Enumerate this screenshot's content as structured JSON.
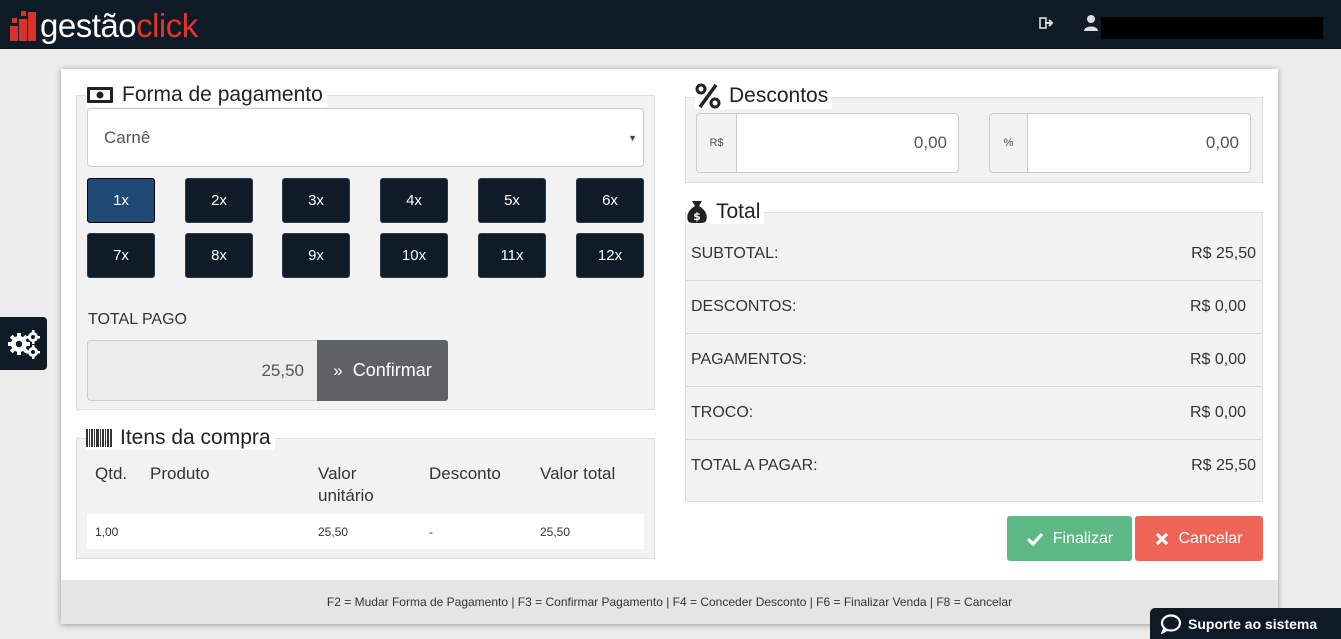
{
  "topbar": {
    "logo_part1": "gestão",
    "logo_part2": "click",
    "logout_icon": "sign-out-icon",
    "user_icon": "user-icon",
    "user_name": "",
    "colors": {
      "bar": "#0f1a27",
      "brand_red": "#e0342c"
    }
  },
  "payment": {
    "title": "Forma de pagamento",
    "title_icon": "money-bill-icon",
    "method_value": "Carnê",
    "installments": [
      "1x",
      "2x",
      "3x",
      "4x",
      "5x",
      "6x",
      "7x",
      "8x",
      "9x",
      "10x",
      "11x",
      "12x"
    ],
    "selected_installment": "1x",
    "total_paid_label": "TOTAL PAGO",
    "total_paid_value": "25,50",
    "confirm_label": "Confirmar"
  },
  "items": {
    "title": "Itens da compra",
    "title_icon": "barcode-icon",
    "columns": {
      "qty": "Qtd.",
      "product": "Produto",
      "unit_line1": "Valor",
      "unit_line2": "unitário",
      "discount": "Desconto",
      "total": "Valor total"
    },
    "rows": [
      {
        "qty": "1,00",
        "product": "",
        "unit": "25,50",
        "discount": "-",
        "total": "25,50"
      }
    ]
  },
  "discounts": {
    "title": "Descontos",
    "title_icon": "percent-icon",
    "currency_prefix": "R$",
    "currency_value": "0,00",
    "percent_prefix": "%",
    "percent_value": "0,00"
  },
  "totals": {
    "title": "Total",
    "title_icon": "money-bag-icon",
    "rows": [
      {
        "label": "SUBTOTAL:",
        "value": "R$ 25,50"
      },
      {
        "label": "DESCONTOS:",
        "value": "R$ 0,00"
      },
      {
        "label": "PAGAMENTOS:",
        "value": "R$ 0,00"
      },
      {
        "label": "TROCO:",
        "value": "R$ 0,00"
      },
      {
        "label": "TOTAL A PAGAR:",
        "value": "R$ 25,50"
      }
    ]
  },
  "actions": {
    "finalize_label": "Finalizar",
    "cancel_label": "Cancelar",
    "colors": {
      "finalize": "#5cb885",
      "cancel": "#ee6456"
    }
  },
  "footer": {
    "shortcuts": "F2 = Mudar Forma de Pagamento | F3 = Confirmar Pagamento | F4 = Conceder Desconto | F6 = Finalizar Venda | F8 = Cancelar"
  },
  "support": {
    "label": "Suporte ao sistema",
    "icon": "chat-bubble-icon"
  },
  "side": {
    "settings_icon": "gears-icon"
  }
}
